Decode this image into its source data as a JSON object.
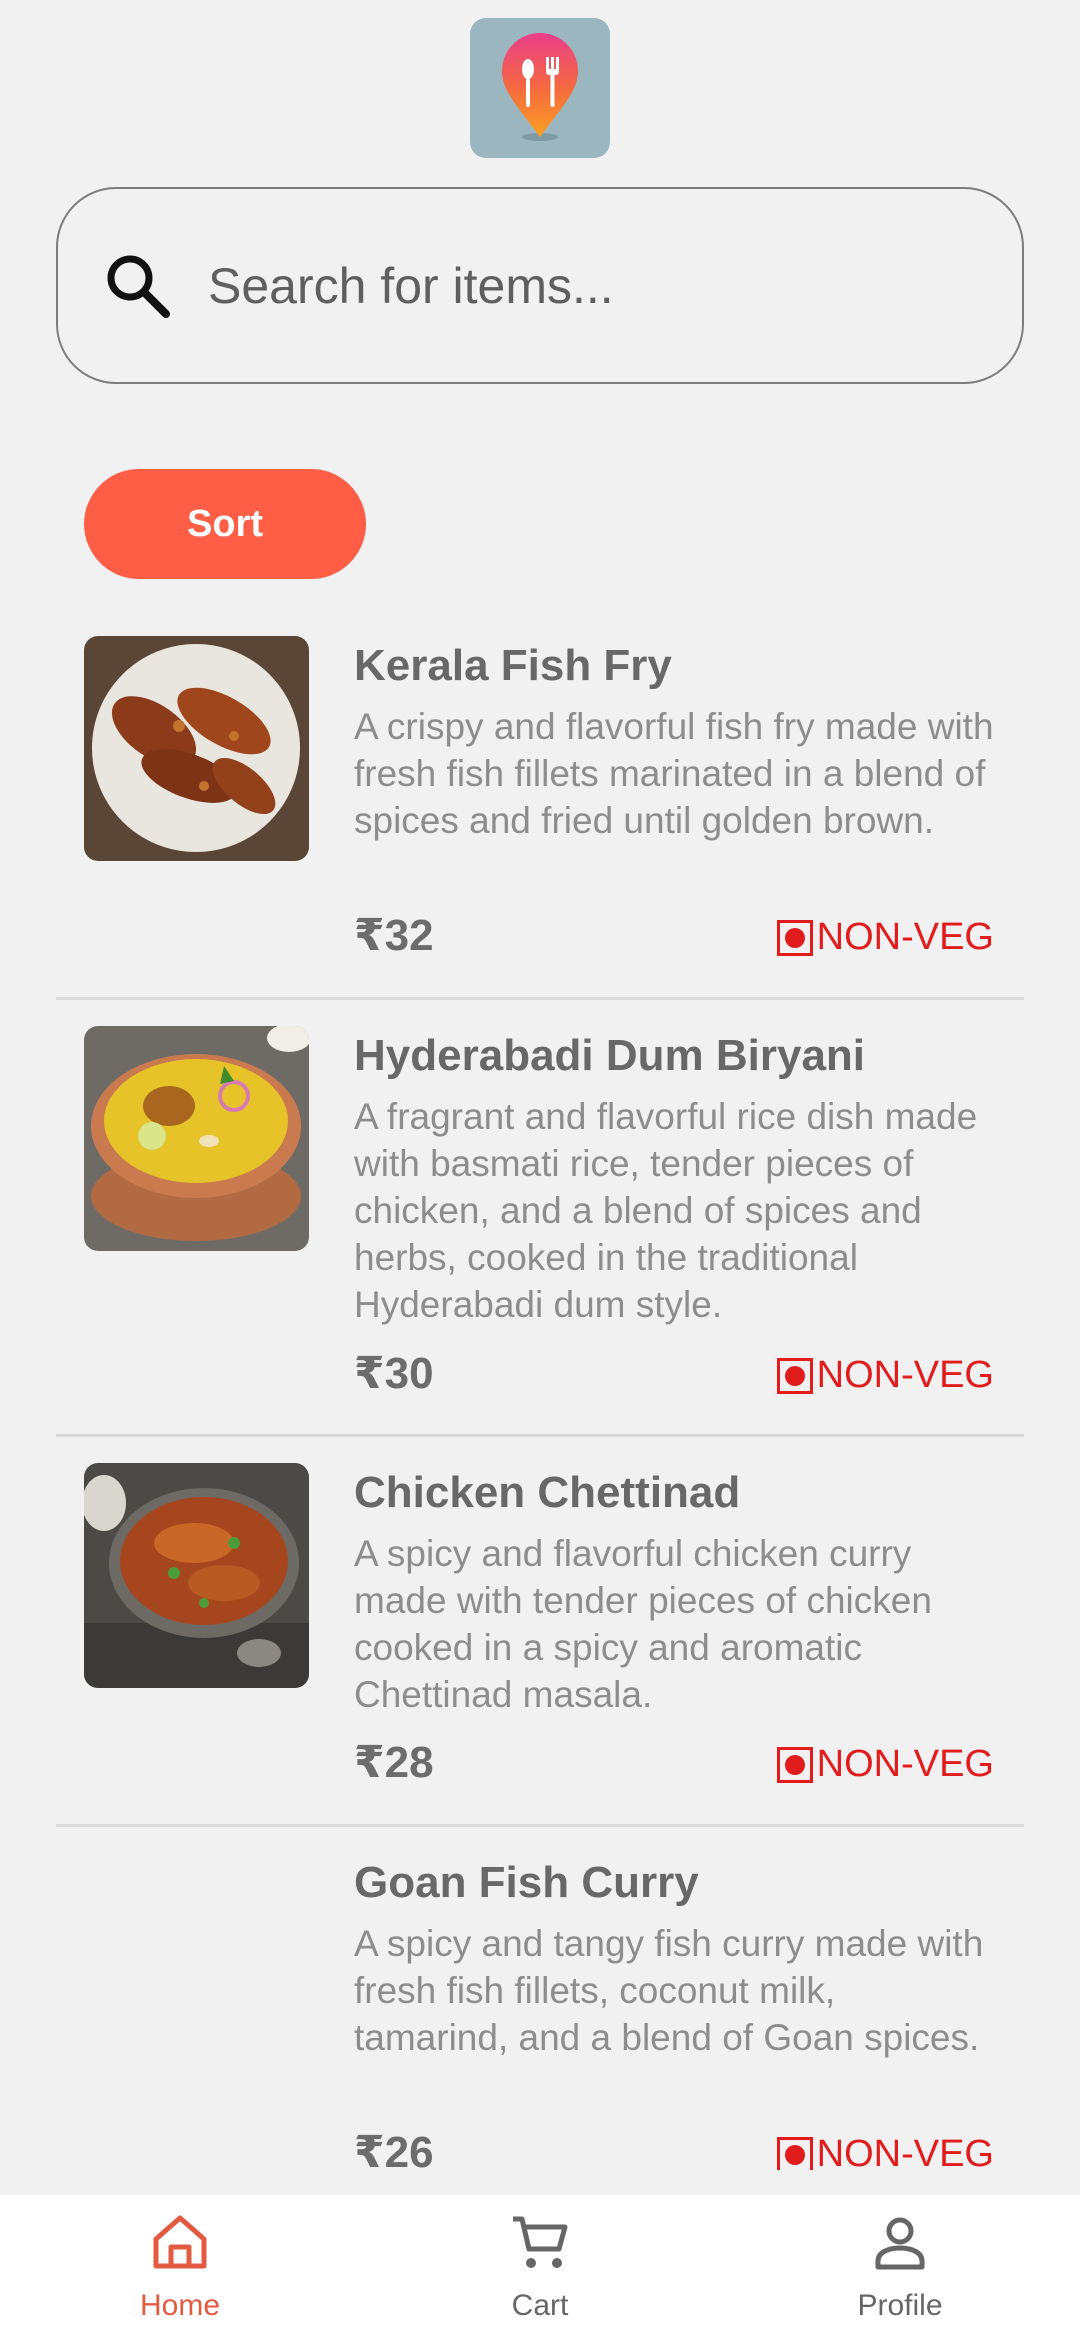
{
  "search": {
    "placeholder": "Search for items..."
  },
  "sort_label": "Sort",
  "items": [
    {
      "name": "Kerala Fish Fry",
      "description": "A crispy and flavorful fish fry made with fresh fish fillets marinated in a blend of spices and fried until golden brown.",
      "price": "₹32",
      "badge": "NON-VEG"
    },
    {
      "name": "Hyderabadi Dum Biryani",
      "description": "A fragrant and flavorful rice dish made with basmati rice, tender pieces of chicken, and a blend of spices and herbs, cooked in the traditional Hyderabadi dum style.",
      "price": "₹30",
      "badge": "NON-VEG"
    },
    {
      "name": "Chicken Chettinad",
      "description": "A spicy and flavorful chicken curry made with tender pieces of chicken cooked in a spicy and aromatic Chettinad masala.",
      "price": "₹28",
      "badge": "NON-VEG"
    },
    {
      "name": "Goan Fish Curry",
      "description": "A spicy and tangy fish curry made with fresh fish fillets, coconut milk, tamarind, and a blend of Goan spices.",
      "price": "₹26",
      "badge": "NON-VEG"
    }
  ],
  "nav": {
    "home": "Home",
    "cart": "Cart",
    "profile": "Profile"
  },
  "colors": {
    "accent": "#fe5e45",
    "nonveg": "#e11c1c",
    "active_tab": "#e25b41"
  }
}
